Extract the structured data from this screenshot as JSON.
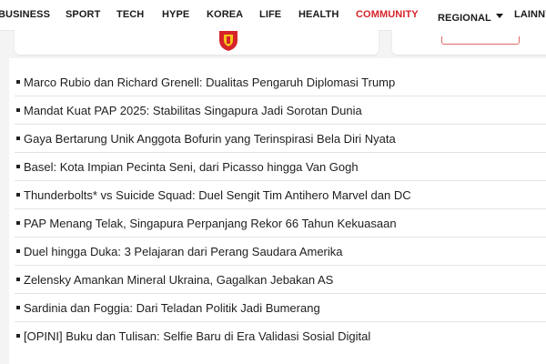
{
  "nav": {
    "items": [
      {
        "label": "BUSINESS"
      },
      {
        "label": "SPORT"
      },
      {
        "label": "TECH"
      },
      {
        "label": "HYPE"
      },
      {
        "label": "KOREA"
      },
      {
        "label": "LIFE"
      },
      {
        "label": "HEALTH"
      },
      {
        "label": "COMMUNITY"
      },
      {
        "label": "REGIONAL"
      },
      {
        "label": "LAINNYA"
      }
    ],
    "active_label": "COMMUNITY",
    "active_color": "#d6232a"
  },
  "articles": [
    {
      "title": "Marco Rubio dan Richard Grenell: Dualitas Pengaruh Diplomasi Trump"
    },
    {
      "title": "Mandat Kuat PAP 2025: Stabilitas Singapura Jadi Sorotan Dunia"
    },
    {
      "title": "Gaya Bertarung Unik Anggota Bofurin yang Terinspirasi Bela Diri Nyata"
    },
    {
      "title": "Basel: Kota Impian Pecinta Seni, dari Picasso hingga Van Gogh"
    },
    {
      "title": "Thunderbolts* vs Suicide Squad: Duel Sengit Tim Antihero Marvel dan DC"
    },
    {
      "title": "PAP Menang Telak, Singapura Perpanjang Rekor 66 Tahun Kekuasaan"
    },
    {
      "title": "Duel hingga Duka: 3 Pelajaran dari Perang Saudara Amerika"
    },
    {
      "title": "Zelensky Amankan Mineral Ukraina, Gagalkan Jebakan AS"
    },
    {
      "title": "Sardinia dan Foggia: Dari Teladan Politik Jadi Bumerang"
    },
    {
      "title": "[OPINI] Buku dan Tulisan: Selfie Baru di Era Validasi Sosial Digital"
    }
  ],
  "icons": {
    "logo": "shield-logo-icon",
    "bullet": "square-bullet-icon",
    "dropdown": "caret-down-icon"
  }
}
